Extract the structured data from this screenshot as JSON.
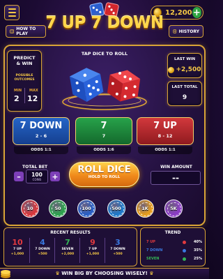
{
  "header": {
    "coins": "12,200",
    "logo": "7 UP 7 DOWN",
    "how_to_play": "HOW TO PLAY",
    "history": "HISTORY"
  },
  "predict": {
    "title_line1": "PREDICT",
    "title_line2": "& WIN",
    "possible_line1": "POSSIBLE",
    "possible_line2": "OUTCOMES",
    "min_label": "MIN",
    "min_value": "2",
    "max_label": "MAX",
    "max_value": "12"
  },
  "stage": {
    "tap_label": "TAP DICE TO ROLL",
    "dice": [
      {
        "color": "blue",
        "face": 5
      },
      {
        "color": "red",
        "face": 5
      }
    ]
  },
  "stats": {
    "last_win_label": "LAST WIN",
    "last_win_value": "+2,500",
    "last_total_label": "LAST TOTAL",
    "last_total_value": "9"
  },
  "bets": [
    {
      "title": "7 DOWN",
      "range": "2 - 6",
      "odds": "ODDS 1:1",
      "color": "#2565c8"
    },
    {
      "title": "7",
      "range": "7",
      "odds": "ODDS 1:6",
      "color": "#27a24a"
    },
    {
      "title": "7 UP",
      "range": "8 - 12",
      "odds": "ODDS 1:1",
      "color": "#d2383c"
    }
  ],
  "controls": {
    "total_bet_label": "TOTAL BET",
    "minus": "–",
    "plus": "+",
    "bet_value": "100",
    "bet_unit": "COINS",
    "roll_label": "ROLL DICE",
    "roll_sub": "HOLD TO ROLL",
    "win_amount_label": "WIN AMOUNT",
    "win_amount_value": "--"
  },
  "chips": [
    {
      "label": "10",
      "color": "#d8383c"
    },
    {
      "label": "50",
      "color": "#2ea24e"
    },
    {
      "label": "100",
      "color": "#2a5fc4"
    },
    {
      "label": "500",
      "color": "#1f78c8"
    },
    {
      "label": "1K",
      "color": "#e59c1e"
    },
    {
      "label": "5K",
      "color": "#8a3dc4"
    }
  ],
  "recent": {
    "title": "RECENT RESULTS",
    "items": [
      {
        "num": "10",
        "label": "7 UP",
        "amount": "+1,000",
        "color": "#e23a3f"
      },
      {
        "num": "4",
        "label": "7 DOWN",
        "amount": "+500",
        "color": "#3a79e0"
      },
      {
        "num": "7",
        "label": "SEVEN",
        "amount": "+2,000",
        "color": "#33b556"
      },
      {
        "num": "9",
        "label": "7 UP",
        "amount": "+1,000",
        "color": "#e23a3f"
      },
      {
        "num": "3",
        "label": "7 DOWN",
        "amount": "+500",
        "color": "#3a79e0"
      }
    ]
  },
  "trend": {
    "title": "TREND",
    "rows": [
      {
        "name": "7 UP",
        "pct": "40%",
        "color": "#e23a3f"
      },
      {
        "name": "7 DOWN",
        "pct": "35%",
        "color": "#3a79e0"
      },
      {
        "name": "SEVEN",
        "pct": "25%",
        "color": "#33b556"
      }
    ]
  },
  "footer": {
    "banner": "WIN BIG BY CHOOSING WISELY!"
  }
}
